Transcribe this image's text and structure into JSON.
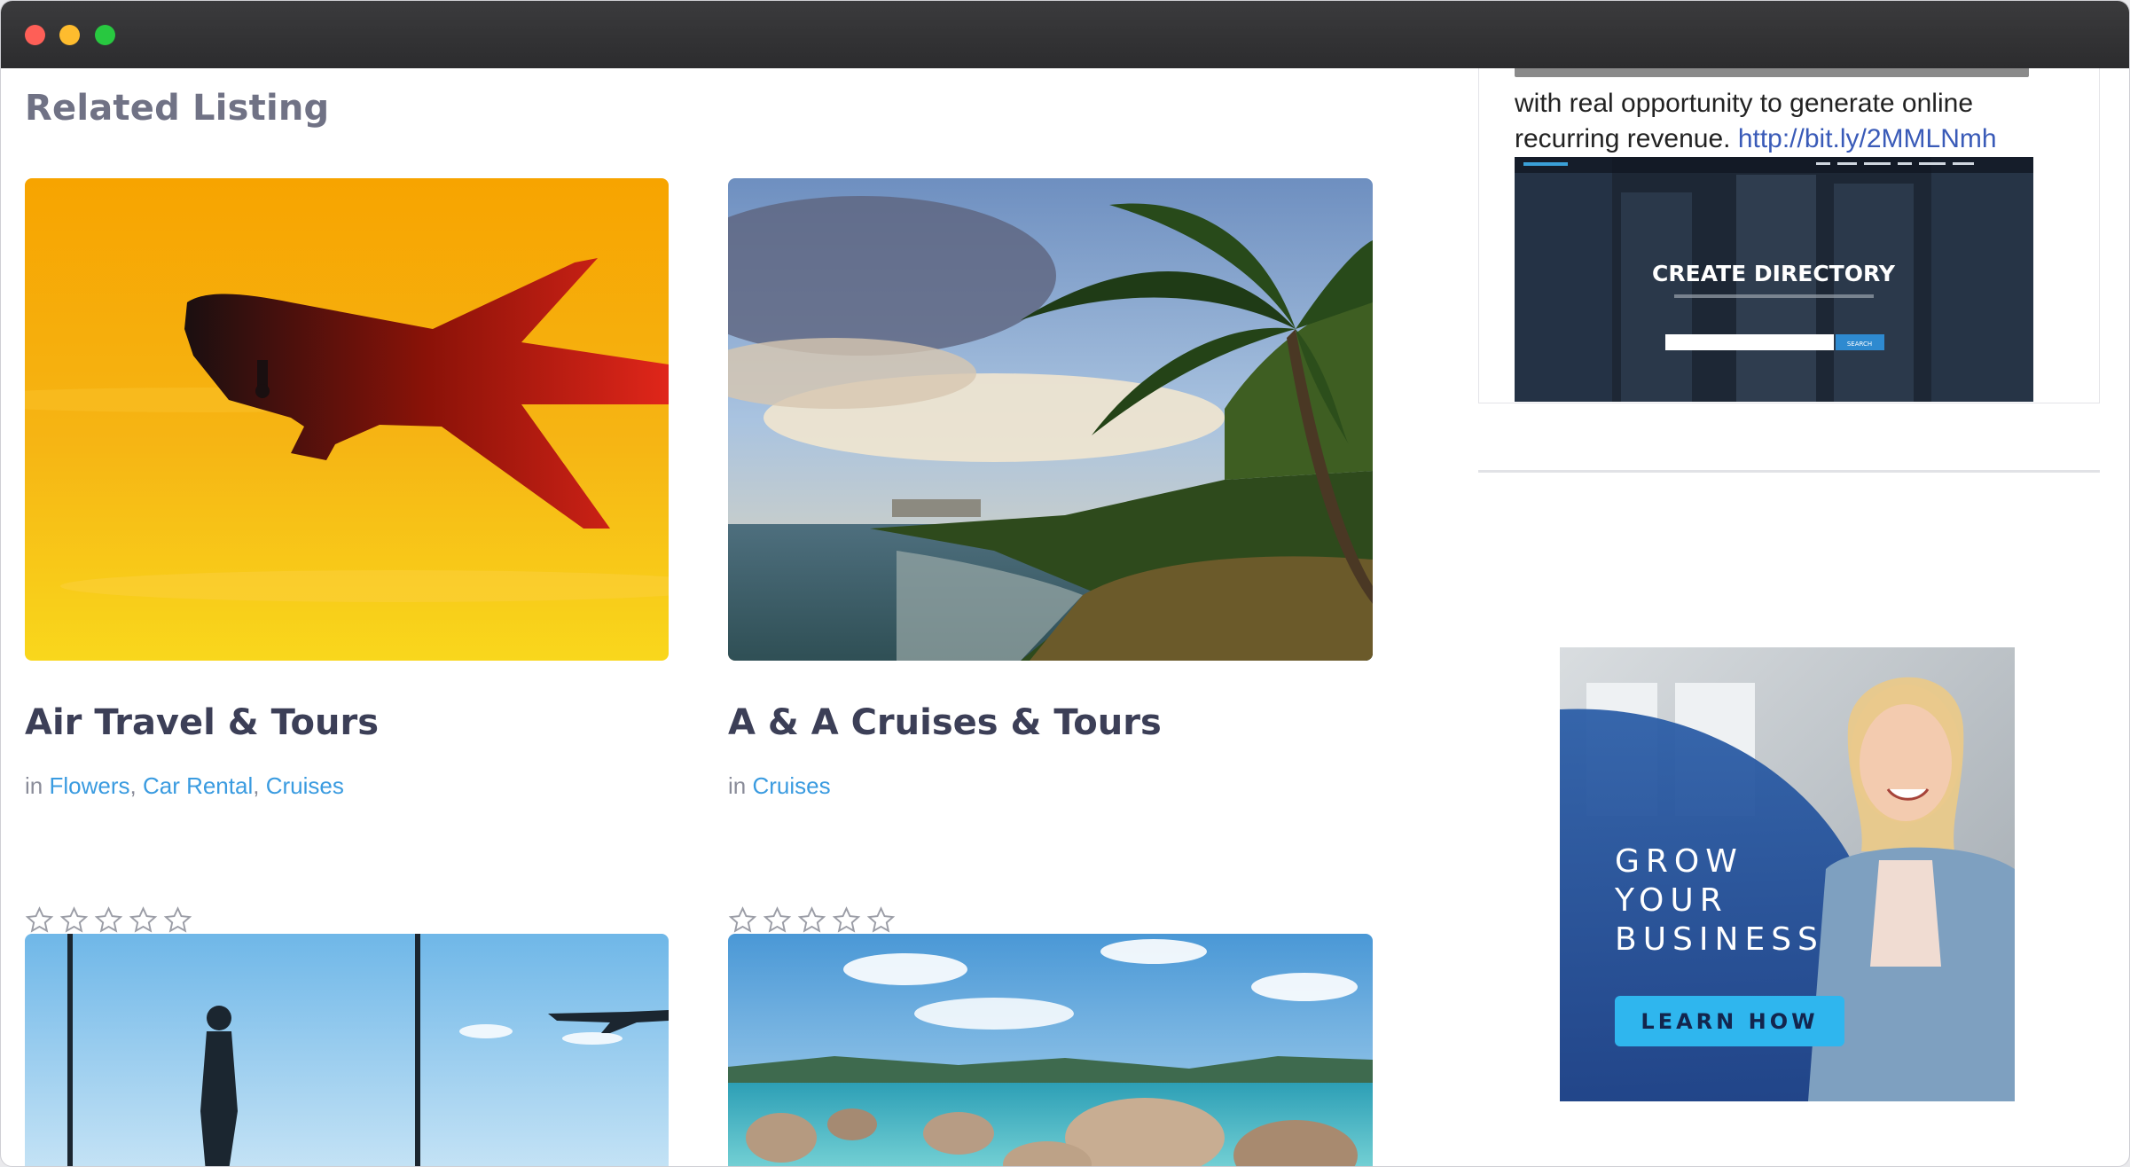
{
  "section_title": "Related Listing",
  "listings": [
    {
      "title": "Air Travel & Tours",
      "in_label": "in",
      "categories": [
        "Flowers",
        "Car Rental",
        "Cruises"
      ],
      "rating": 0
    },
    {
      "title": "A & A Cruises & Tours",
      "in_label": "in",
      "categories": [
        "Cruises"
      ],
      "rating": 0
    }
  ],
  "sidebar": {
    "post": {
      "text_line1": "with real opportunity to generate online",
      "text_line2": "recurring revenue.",
      "link": "http://bit.ly/2MMLNmh",
      "preview_heading": "CREATE DIRECTORY",
      "preview_button": "SEARCH"
    },
    "ad": {
      "headline_lines": [
        "GROW",
        "YOUR",
        "BUSINESS"
      ],
      "button_label": "LEARN HOW"
    }
  },
  "colors": {
    "link": "#3a9be0",
    "title": "#3c3f57",
    "ad_button": "#2fb6ee",
    "ad_panel": "#1f4f9d"
  }
}
